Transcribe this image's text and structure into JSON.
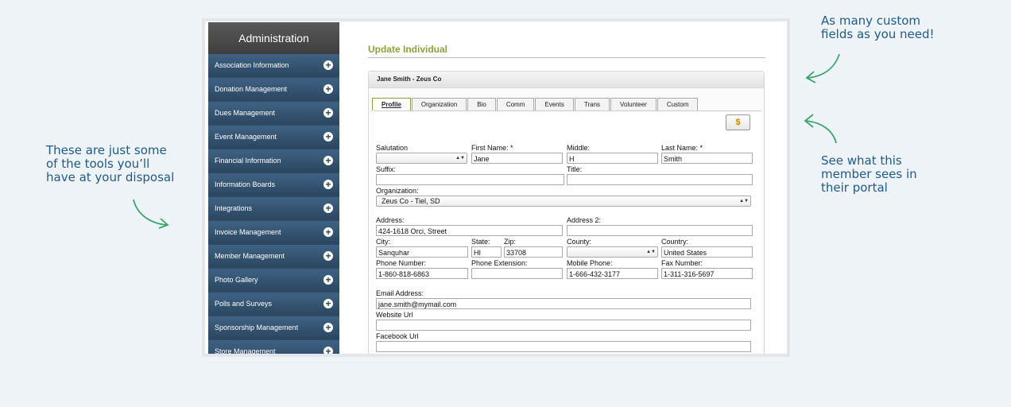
{
  "callouts": {
    "left": [
      "These are just some",
      "of the tools you’ll",
      "have at your disposal"
    ],
    "top": [
      "As many custom",
      "fields as you need!"
    ],
    "right": [
      "See what this",
      "member sees in",
      "their portal"
    ]
  },
  "sidebar": {
    "title": "Administration",
    "items": [
      "Association Information",
      "Donation Management",
      "Dues Management",
      "Event Management",
      "Financial Information",
      "Information Boards",
      "Integrations",
      "Invoice Management",
      "Member Management",
      "Photo Gallery",
      "Polls and Surveys",
      "Sponsorship Management",
      "Store Management"
    ],
    "expand_symbol": "+"
  },
  "page": {
    "title": "Update Individual"
  },
  "panel": {
    "header": "Jane Smith - Zeus Co"
  },
  "tabs": [
    "Profile",
    "Organization",
    "Bio",
    "Comm",
    "Events",
    "Trans",
    "Volunteer",
    "Custom"
  ],
  "portal_button": {
    "icon": "member-portal-icon",
    "glyph": "$"
  },
  "form": {
    "salutation": {
      "label": "Salutation",
      "value": ""
    },
    "first_name": {
      "label": "First Name: *",
      "value": "Jane"
    },
    "middle": {
      "label": "Middle:",
      "value": "H"
    },
    "last_name": {
      "label": "Last Name: *",
      "value": "Smith"
    },
    "suffix": {
      "label": "Suffix:",
      "value": ""
    },
    "title": {
      "label": "Title:",
      "value": ""
    },
    "organization": {
      "label": "Organization:",
      "value": "Zeus Co - Tiel, SD"
    },
    "address": {
      "label": "Address:",
      "value": "424-1618 Orci, Street"
    },
    "address2": {
      "label": "Address 2:",
      "value": ""
    },
    "city": {
      "label": "City:",
      "value": "Sanquhar"
    },
    "state": {
      "label": "State:",
      "value": "HI"
    },
    "zip": {
      "label": "Zip:",
      "value": "33708"
    },
    "county": {
      "label": "County:",
      "value": ""
    },
    "country": {
      "label": "Country:",
      "value": "United States"
    },
    "phone": {
      "label": "Phone Number:",
      "value": "1-860-818-6863"
    },
    "phone_ext": {
      "label": "Phone Extension:",
      "value": ""
    },
    "mobile": {
      "label": "Mobile Phone:",
      "value": "1-666-432-3177"
    },
    "fax": {
      "label": "Fax Number:",
      "value": "1-311-316-5697"
    },
    "email": {
      "label": "Email Address:",
      "value": "jane.smith@mymail.com"
    },
    "website": {
      "label": "Website Url",
      "value": ""
    },
    "facebook": {
      "label": "Facebook Url",
      "value": ""
    }
  },
  "colors": {
    "accent_green": "#8aa23a",
    "sidebar_blue": "#2b4761",
    "callout_blue": "#1f5a8a",
    "arrow_green": "#3aa56b"
  }
}
